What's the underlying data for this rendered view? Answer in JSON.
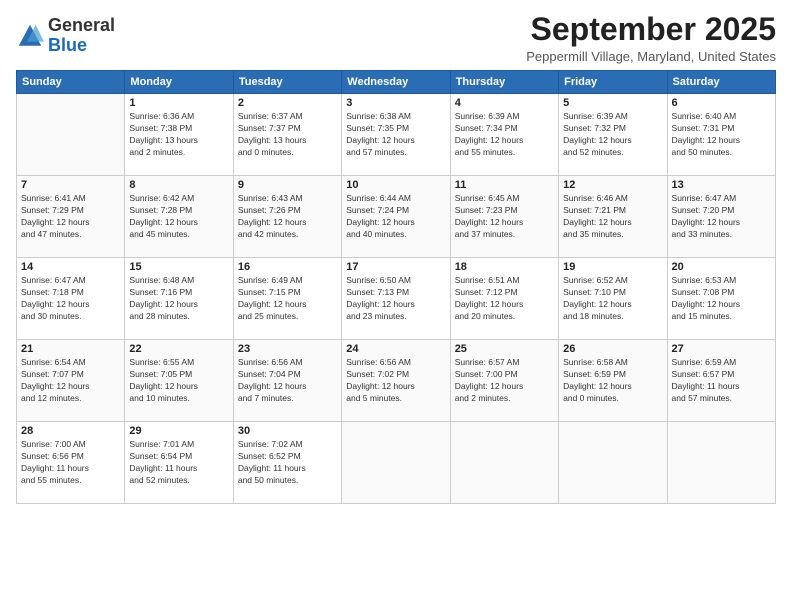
{
  "logo": {
    "general": "General",
    "blue": "Blue"
  },
  "header": {
    "month": "September 2025",
    "location": "Peppermill Village, Maryland, United States"
  },
  "weekdays": [
    "Sunday",
    "Monday",
    "Tuesday",
    "Wednesday",
    "Thursday",
    "Friday",
    "Saturday"
  ],
  "weeks": [
    [
      {
        "day": "",
        "info": ""
      },
      {
        "day": "1",
        "info": "Sunrise: 6:36 AM\nSunset: 7:38 PM\nDaylight: 13 hours\nand 2 minutes."
      },
      {
        "day": "2",
        "info": "Sunrise: 6:37 AM\nSunset: 7:37 PM\nDaylight: 13 hours\nand 0 minutes."
      },
      {
        "day": "3",
        "info": "Sunrise: 6:38 AM\nSunset: 7:35 PM\nDaylight: 12 hours\nand 57 minutes."
      },
      {
        "day": "4",
        "info": "Sunrise: 6:39 AM\nSunset: 7:34 PM\nDaylight: 12 hours\nand 55 minutes."
      },
      {
        "day": "5",
        "info": "Sunrise: 6:39 AM\nSunset: 7:32 PM\nDaylight: 12 hours\nand 52 minutes."
      },
      {
        "day": "6",
        "info": "Sunrise: 6:40 AM\nSunset: 7:31 PM\nDaylight: 12 hours\nand 50 minutes."
      }
    ],
    [
      {
        "day": "7",
        "info": "Sunrise: 6:41 AM\nSunset: 7:29 PM\nDaylight: 12 hours\nand 47 minutes."
      },
      {
        "day": "8",
        "info": "Sunrise: 6:42 AM\nSunset: 7:28 PM\nDaylight: 12 hours\nand 45 minutes."
      },
      {
        "day": "9",
        "info": "Sunrise: 6:43 AM\nSunset: 7:26 PM\nDaylight: 12 hours\nand 42 minutes."
      },
      {
        "day": "10",
        "info": "Sunrise: 6:44 AM\nSunset: 7:24 PM\nDaylight: 12 hours\nand 40 minutes."
      },
      {
        "day": "11",
        "info": "Sunrise: 6:45 AM\nSunset: 7:23 PM\nDaylight: 12 hours\nand 37 minutes."
      },
      {
        "day": "12",
        "info": "Sunrise: 6:46 AM\nSunset: 7:21 PM\nDaylight: 12 hours\nand 35 minutes."
      },
      {
        "day": "13",
        "info": "Sunrise: 6:47 AM\nSunset: 7:20 PM\nDaylight: 12 hours\nand 33 minutes."
      }
    ],
    [
      {
        "day": "14",
        "info": "Sunrise: 6:47 AM\nSunset: 7:18 PM\nDaylight: 12 hours\nand 30 minutes."
      },
      {
        "day": "15",
        "info": "Sunrise: 6:48 AM\nSunset: 7:16 PM\nDaylight: 12 hours\nand 28 minutes."
      },
      {
        "day": "16",
        "info": "Sunrise: 6:49 AM\nSunset: 7:15 PM\nDaylight: 12 hours\nand 25 minutes."
      },
      {
        "day": "17",
        "info": "Sunrise: 6:50 AM\nSunset: 7:13 PM\nDaylight: 12 hours\nand 23 minutes."
      },
      {
        "day": "18",
        "info": "Sunrise: 6:51 AM\nSunset: 7:12 PM\nDaylight: 12 hours\nand 20 minutes."
      },
      {
        "day": "19",
        "info": "Sunrise: 6:52 AM\nSunset: 7:10 PM\nDaylight: 12 hours\nand 18 minutes."
      },
      {
        "day": "20",
        "info": "Sunrise: 6:53 AM\nSunset: 7:08 PM\nDaylight: 12 hours\nand 15 minutes."
      }
    ],
    [
      {
        "day": "21",
        "info": "Sunrise: 6:54 AM\nSunset: 7:07 PM\nDaylight: 12 hours\nand 12 minutes."
      },
      {
        "day": "22",
        "info": "Sunrise: 6:55 AM\nSunset: 7:05 PM\nDaylight: 12 hours\nand 10 minutes."
      },
      {
        "day": "23",
        "info": "Sunrise: 6:56 AM\nSunset: 7:04 PM\nDaylight: 12 hours\nand 7 minutes."
      },
      {
        "day": "24",
        "info": "Sunrise: 6:56 AM\nSunset: 7:02 PM\nDaylight: 12 hours\nand 5 minutes."
      },
      {
        "day": "25",
        "info": "Sunrise: 6:57 AM\nSunset: 7:00 PM\nDaylight: 12 hours\nand 2 minutes."
      },
      {
        "day": "26",
        "info": "Sunrise: 6:58 AM\nSunset: 6:59 PM\nDaylight: 12 hours\nand 0 minutes."
      },
      {
        "day": "27",
        "info": "Sunrise: 6:59 AM\nSunset: 6:57 PM\nDaylight: 11 hours\nand 57 minutes."
      }
    ],
    [
      {
        "day": "28",
        "info": "Sunrise: 7:00 AM\nSunset: 6:56 PM\nDaylight: 11 hours\nand 55 minutes."
      },
      {
        "day": "29",
        "info": "Sunrise: 7:01 AM\nSunset: 6:54 PM\nDaylight: 11 hours\nand 52 minutes."
      },
      {
        "day": "30",
        "info": "Sunrise: 7:02 AM\nSunset: 6:52 PM\nDaylight: 11 hours\nand 50 minutes."
      },
      {
        "day": "",
        "info": ""
      },
      {
        "day": "",
        "info": ""
      },
      {
        "day": "",
        "info": ""
      },
      {
        "day": "",
        "info": ""
      }
    ]
  ]
}
